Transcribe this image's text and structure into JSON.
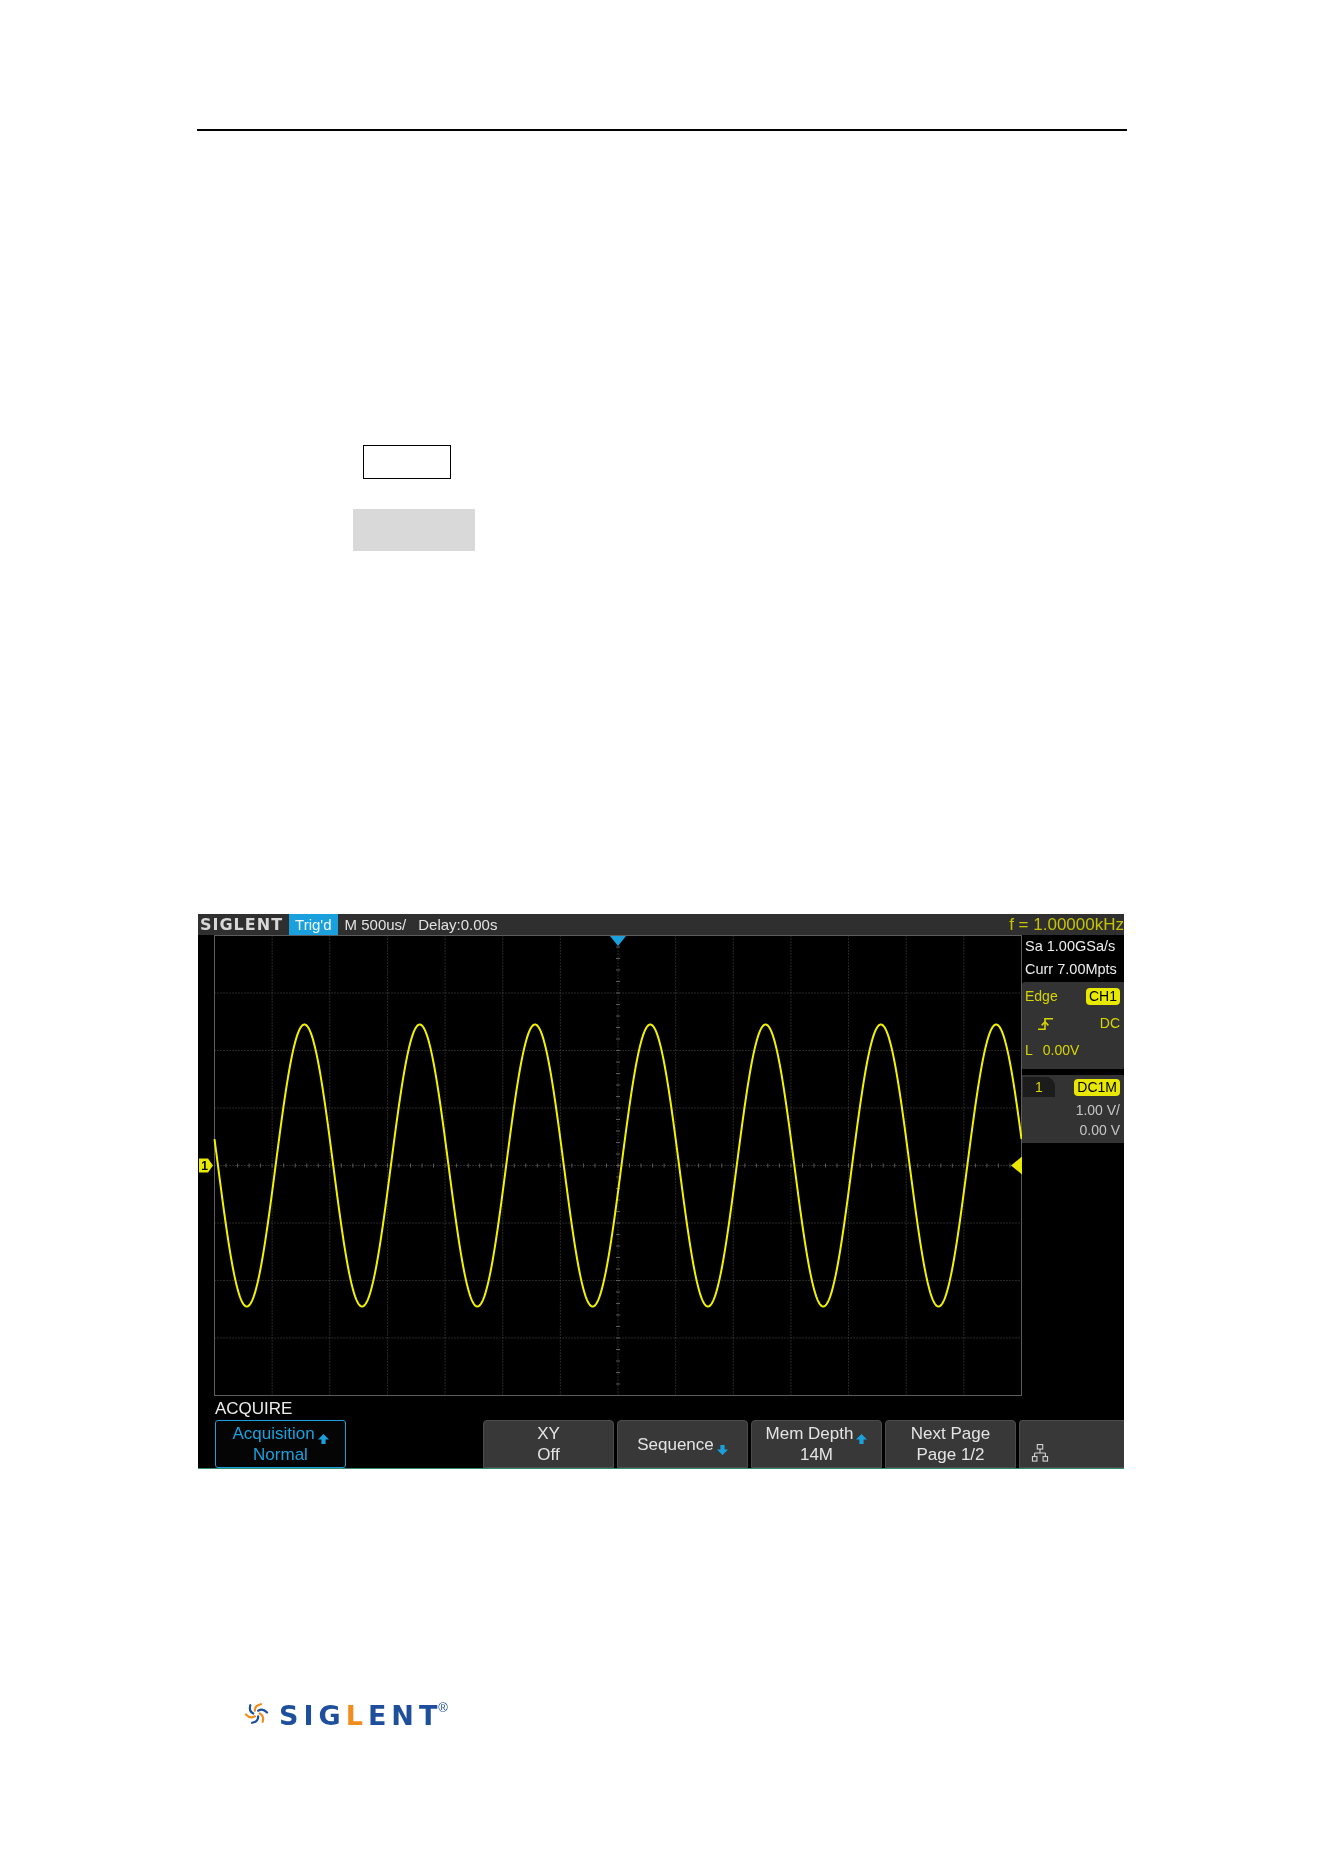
{
  "scope": {
    "status_bar": {
      "brand": "SIGLENT",
      "trigger_status": "Trig'd",
      "timebase": "M 500us/",
      "delay": "Delay:0.00s",
      "frequency": "f = 1.00000kHz"
    },
    "display": {
      "channel_marker": "1"
    },
    "acquisition": {
      "sample_rate": "Sa 1.00GSa/s",
      "memory_depth": "Curr 7.00Mpts"
    },
    "trigger": {
      "type": "Edge",
      "source": "CH1",
      "coupling": "DC",
      "level_label": "L",
      "level_value": "0.00V"
    },
    "channel": {
      "number": "1",
      "coupling": "DC1M",
      "scale": "1.00 V/",
      "offset": "0.00 V"
    },
    "menu": {
      "title": "ACQUIRE",
      "buttons": [
        {
          "kind": "up",
          "lines": [
            "Acquisition",
            "Normal"
          ],
          "selected": true
        },
        {
          "kind": "blank"
        },
        {
          "kind": "plain",
          "lines": [
            "XY",
            "Off"
          ],
          "selected": false
        },
        {
          "kind": "down",
          "lines": [
            "Sequence"
          ],
          "selected": false
        },
        {
          "kind": "up",
          "lines": [
            "Mem Depth",
            "14M"
          ],
          "selected": false
        },
        {
          "kind": "plain",
          "lines": [
            "Next Page",
            "Page 1/2"
          ],
          "selected": false
        },
        {
          "kind": "status"
        }
      ]
    }
  },
  "logo": {
    "segments": [
      {
        "text": "SIG",
        "color": "#1d4f9c"
      },
      {
        "text": "L",
        "color": "#f18d1f"
      },
      {
        "text": "ENT",
        "color": "#1d4f9c"
      }
    ],
    "registered": "®"
  }
}
